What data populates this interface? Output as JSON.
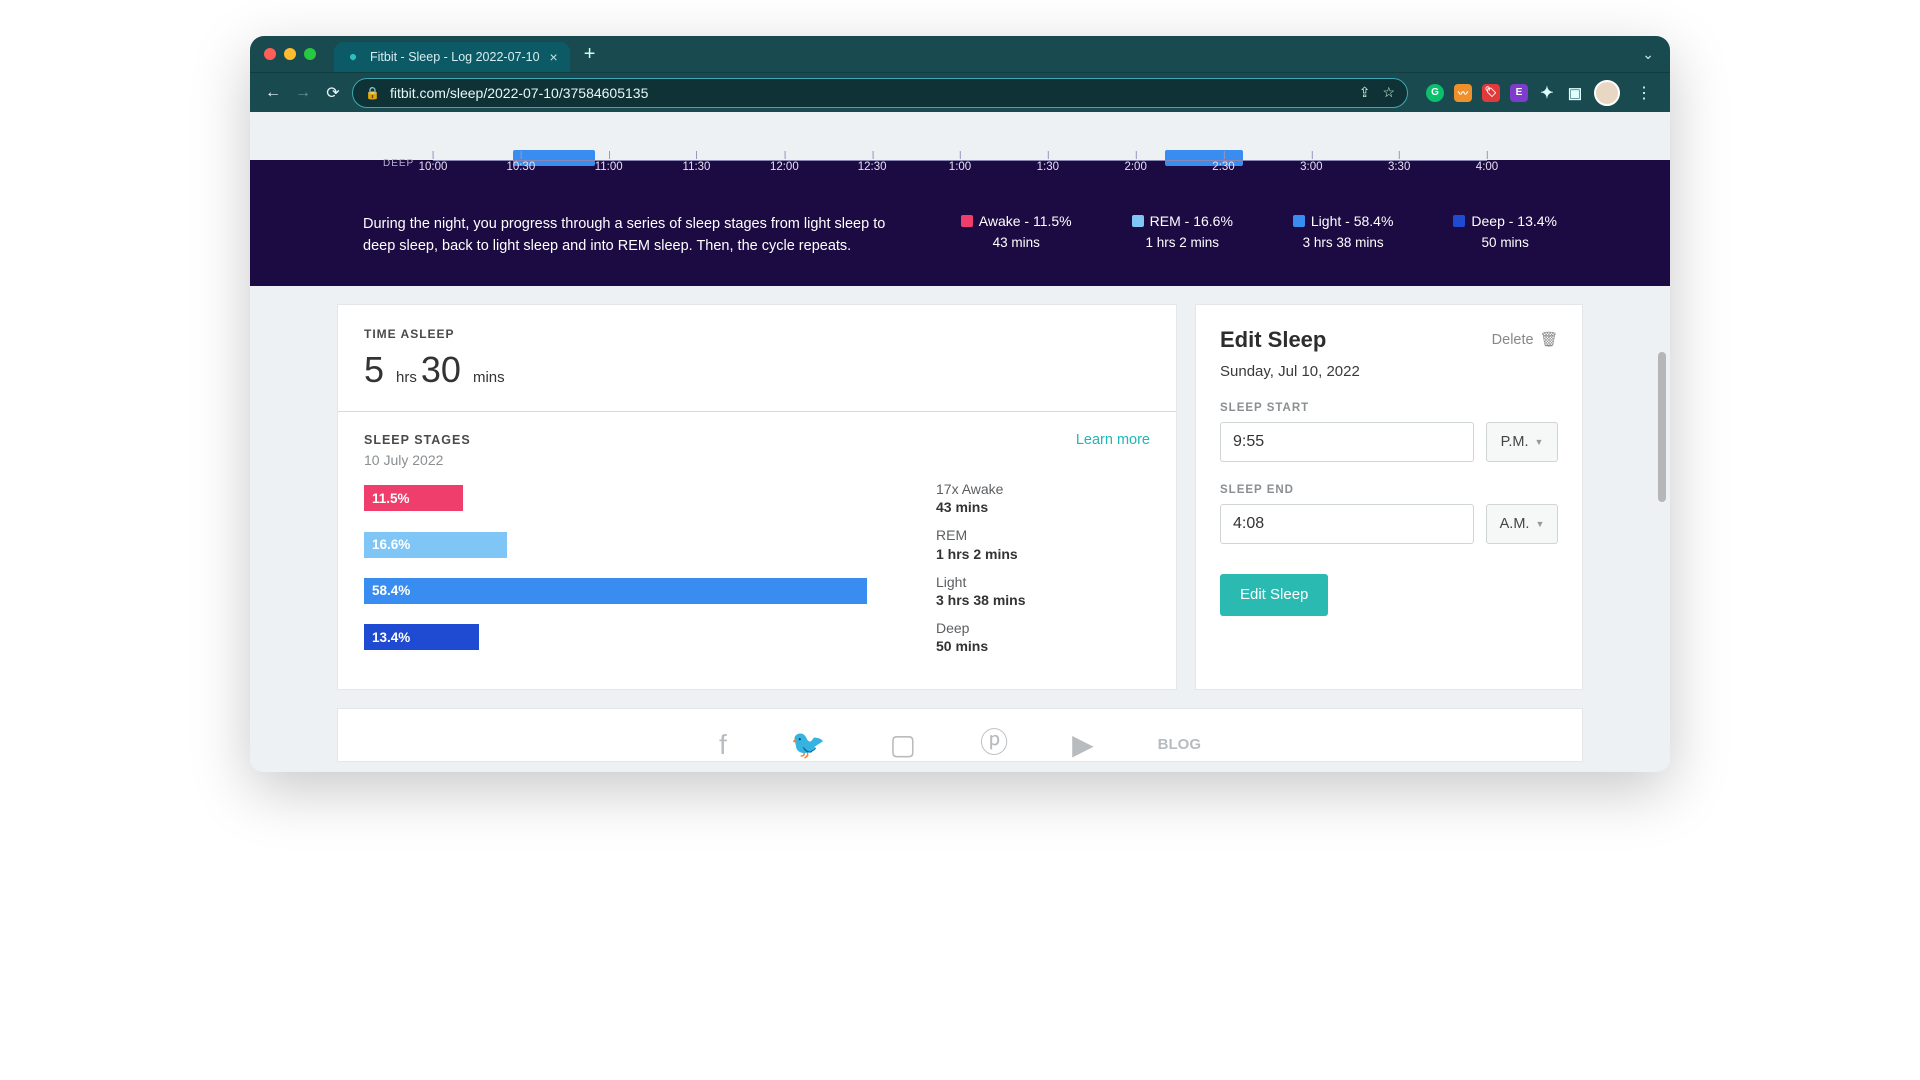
{
  "browser": {
    "tab_title": "Fitbit - Sleep - Log 2022-07-10",
    "url": "fitbit.com/sleep/2022-07-10/37584605135"
  },
  "hero": {
    "deep_label": "DEEP",
    "ticks": [
      "10:00",
      "10:30",
      "11:00",
      "11:30",
      "12:00",
      "12:30",
      "1:00",
      "1:30",
      "2:00",
      "2:30",
      "3:00",
      "3:30",
      "4:00"
    ],
    "description": "During the night, you progress through a series of sleep stages from light sleep to deep sleep, back to light sleep and into REM sleep. Then, the cycle repeats.",
    "legend": [
      {
        "name": "Awake",
        "pct": "11.5%",
        "dur": "43 mins",
        "color": "#ef3e6b"
      },
      {
        "name": "REM",
        "pct": "16.6%",
        "dur": "1 hrs 2 mins",
        "color": "#7fc6f7"
      },
      {
        "name": "Light",
        "pct": "58.4%",
        "dur": "3 hrs 38 mins",
        "color": "#3a8df0"
      },
      {
        "name": "Deep",
        "pct": "13.4%",
        "dur": "50 mins",
        "color": "#1e4bd1"
      }
    ]
  },
  "time_asleep": {
    "label": "TIME ASLEEP",
    "hrs_n": "5",
    "hrs_u": "hrs",
    "mins_n": "30",
    "mins_u": "mins"
  },
  "sleep_stages": {
    "label": "SLEEP STAGES",
    "learn_more": "Learn more",
    "date": "10 July 2022",
    "rows": [
      {
        "pct_label": "11.5%",
        "title": "17x Awake",
        "dur": "43 mins"
      },
      {
        "pct_label": "16.6%",
        "title": "REM",
        "dur": "1 hrs 2 mins"
      },
      {
        "pct_label": "58.4%",
        "title": "Light",
        "dur": "3 hrs 38 mins"
      },
      {
        "pct_label": "13.4%",
        "title": "Deep",
        "dur": "50 mins"
      }
    ]
  },
  "edit_sleep": {
    "title": "Edit Sleep",
    "delete": "Delete",
    "date": "Sunday, Jul 10, 2022",
    "start_label": "SLEEP START",
    "start_value": "9:55",
    "start_ampm": "P.M.",
    "end_label": "SLEEP END",
    "end_value": "4:08",
    "end_ampm": "A.M.",
    "button": "Edit Sleep"
  },
  "footer": {
    "blog": "BLOG"
  },
  "chart_data": {
    "type": "bar",
    "title": "Sleep Stages",
    "categories": [
      "Awake",
      "REM",
      "Light",
      "Deep"
    ],
    "series": [
      {
        "name": "percent",
        "values": [
          11.5,
          16.6,
          58.4,
          13.4
        ]
      }
    ],
    "durations_min": [
      43,
      62,
      218,
      50
    ],
    "colors": [
      "#ef3e6b",
      "#7fc6f7",
      "#3a8df0",
      "#1e4bd1"
    ],
    "timeline_ticks": [
      "10:00",
      "10:30",
      "11:00",
      "11:30",
      "12:00",
      "12:30",
      "1:00",
      "1:30",
      "2:00",
      "2:30",
      "3:00",
      "3:30",
      "4:00"
    ],
    "xlabel": "",
    "ylabel": "",
    "ylim": [
      0,
      100
    ]
  }
}
